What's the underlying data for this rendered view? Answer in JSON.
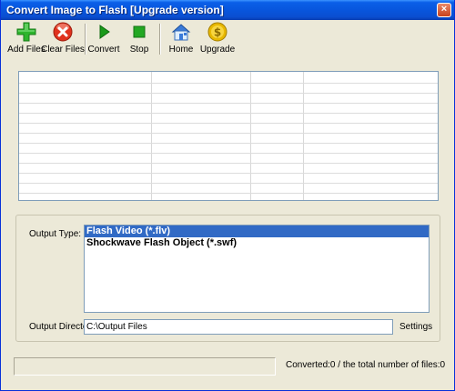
{
  "window": {
    "title": "Convert Image to Flash [Upgrade version]",
    "close_glyph": "×",
    "titlebar_color": "#0a5fe8"
  },
  "toolbar": {
    "add_files": {
      "label": "Add Files",
      "icon": "add-plus-icon",
      "color": "#2db52d"
    },
    "clear_files": {
      "label": "Clear Files",
      "icon": "clear-x-icon",
      "color": "#e0321e"
    },
    "convert": {
      "label": "Convert",
      "icon": "play-icon",
      "color": "#1a9a1a"
    },
    "stop": {
      "label": "Stop",
      "icon": "stop-icon",
      "color": "#23a823"
    },
    "home": {
      "label": "Home",
      "icon": "home-icon",
      "color": "#3a7ad8"
    },
    "upgrade": {
      "label": "Upgrade",
      "icon": "dollar-coin-icon",
      "color": "#e8b800"
    }
  },
  "file_table": {
    "rows": []
  },
  "output": {
    "type_label": "Output Type:",
    "types": [
      {
        "label": "Flash Video (*.flv)",
        "selected": true
      },
      {
        "label": "Shockwave Flash Object (*.swf)",
        "selected": false
      }
    ],
    "dir_label": "Output Directory:",
    "dir_value": "C:\\Output Files",
    "settings_label": "Settings",
    "selection_color": "#316ac5"
  },
  "status": {
    "text": "Converted:0  /  the total number of files:0",
    "progress": 0
  }
}
